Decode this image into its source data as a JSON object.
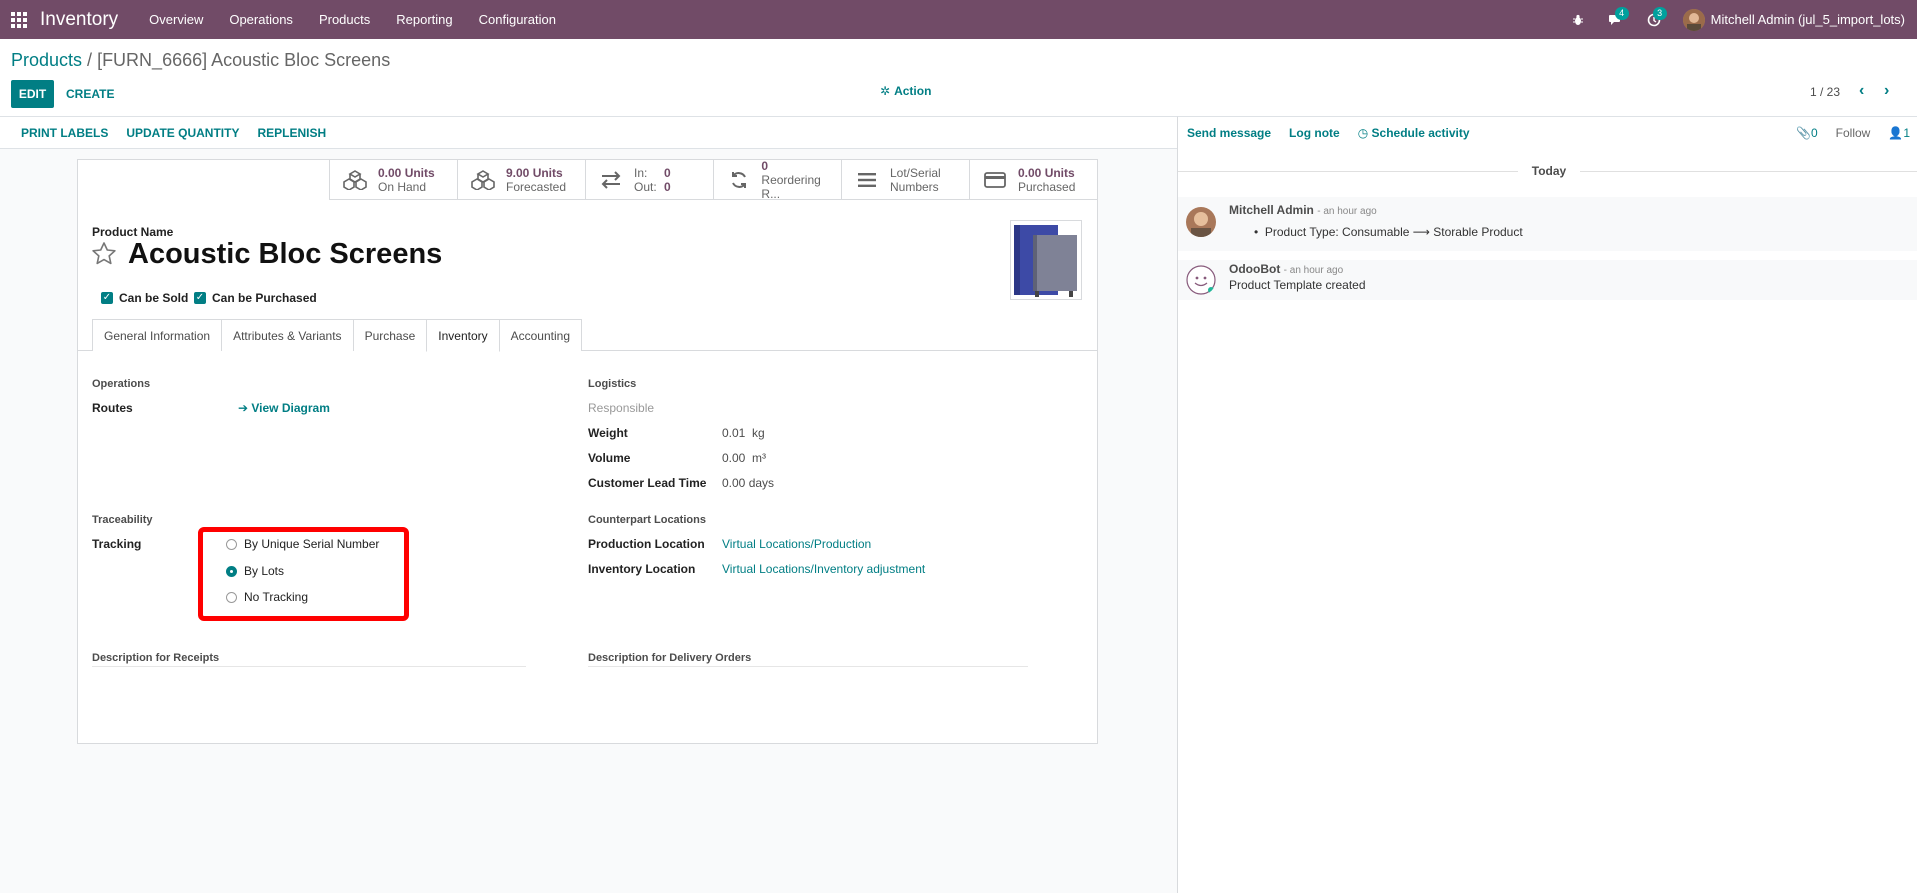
{
  "navbar": {
    "app_name": "Inventory",
    "menu": [
      "Overview",
      "Operations",
      "Products",
      "Reporting",
      "Configuration"
    ],
    "messages_badge": "4",
    "activities_badge": "3",
    "user_name": "Mitchell Admin (jul_5_import_lots)"
  },
  "breadcrumb": {
    "parent": "Products",
    "separator": " / ",
    "current": "[FURN_6666] Acoustic Bloc Screens"
  },
  "controls": {
    "edit": "EDIT",
    "create": "CREATE",
    "action": "Action",
    "pager": "1 / 23"
  },
  "statusbar": {
    "buttons": [
      "PRINT LABELS",
      "UPDATE QUANTITY",
      "REPLENISH"
    ]
  },
  "stat_buttons": {
    "on_hand": {
      "value": "0.00 Units",
      "label": "On Hand"
    },
    "forecasted": {
      "value": "9.00 Units",
      "label": "Forecasted"
    },
    "in_out": {
      "in_label": "In:",
      "in_value": "0",
      "out_label": "Out:",
      "out_value": "0"
    },
    "reordering": {
      "value": "0",
      "label": "Reordering R..."
    },
    "lot_serial": {
      "line1": "Lot/Serial",
      "line2": "Numbers"
    },
    "purchased": {
      "value": "0.00 Units",
      "label": "Purchased"
    }
  },
  "product": {
    "name_label": "Product Name",
    "name": "Acoustic Bloc Screens",
    "can_be_sold": "Can be Sold",
    "can_be_purchased": "Can be Purchased"
  },
  "tabs": [
    "General Information",
    "Attributes & Variants",
    "Purchase",
    "Inventory",
    "Accounting"
  ],
  "inventory": {
    "operations_title": "Operations",
    "routes_label": "Routes",
    "view_diagram": "View Diagram",
    "traceability_title": "Traceability",
    "tracking_label": "Tracking",
    "tracking_options": [
      "By Unique Serial Number",
      "By Lots",
      "No Tracking"
    ],
    "tracking_selected": "By Lots",
    "logistics_title": "Logistics",
    "responsible_label": "Responsible",
    "weight_label": "Weight",
    "weight_value": "0.01",
    "weight_unit": "kg",
    "volume_label": "Volume",
    "volume_value": "0.00",
    "volume_unit": "m³",
    "lead_time_label": "Customer Lead Time",
    "lead_time_value": "0.00 days",
    "counterpart_title": "Counterpart Locations",
    "production_label": "Production Location",
    "production_value": "Virtual Locations/Production",
    "inventory_loc_label": "Inventory Location",
    "inventory_loc_value": "Virtual Locations/Inventory adjustment",
    "desc_receipts": "Description for Receipts",
    "desc_delivery": "Description for Delivery Orders"
  },
  "chatter": {
    "send_message": "Send message",
    "log_note": "Log note",
    "schedule_activity": "Schedule activity",
    "attachments_count": "0",
    "follow": "Follow",
    "followers_count": "1",
    "today": "Today",
    "messages": [
      {
        "author": "Mitchell Admin",
        "date": "- an hour ago",
        "body_old": "Product Type: Consumable",
        "body_new": "Storable Product"
      },
      {
        "author": "OdooBot",
        "date": "- an hour ago",
        "body": "Product Template created"
      }
    ]
  },
  "colors": {
    "navbar": "#714b67",
    "accent": "#017e84",
    "highlight_box": "#ff0000"
  }
}
